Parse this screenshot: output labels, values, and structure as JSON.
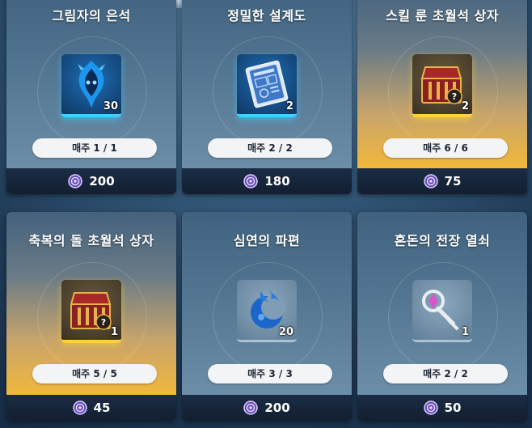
{
  "colors": {
    "card_blue_top": "#40627e",
    "card_gold_bottom": "#f2b83a",
    "price_bar": "#131f31",
    "item_blue_glow": "#3fd0ff",
    "item_gold_glow": "#ffcf3c",
    "pill_bg": "#f3f4f6"
  },
  "currency_icon": "purple-coin-icon",
  "cards": [
    {
      "title": "그림자의 은석",
      "icon": "blue-flame-mask-icon",
      "qty": "30",
      "limit": "매주 1 / 1",
      "price": "200"
    },
    {
      "title": "정밀한 설계도",
      "icon": "blueprint-document-icon",
      "qty": "2",
      "limit": "매주 2 / 2",
      "price": "180"
    },
    {
      "title": "스킬 룬 초월석 상자",
      "icon": "red-treasure-chest-icon",
      "qty": "2",
      "limit": "매주 6 / 6",
      "price": "75"
    },
    {
      "title": "축복의 돌 초월석 상자",
      "icon": "red-treasure-chest-icon",
      "qty": "1",
      "limit": "매주 5 / 5",
      "price": "45"
    },
    {
      "title": "심연의 파편",
      "icon": "blue-crescent-flame-icon",
      "qty": "20",
      "limit": "매주 3 / 3",
      "price": "200"
    },
    {
      "title": "혼돈의 전장 열쇠",
      "icon": "silver-key-icon",
      "qty": "1",
      "limit": "매주 2 / 2",
      "price": "50"
    }
  ]
}
